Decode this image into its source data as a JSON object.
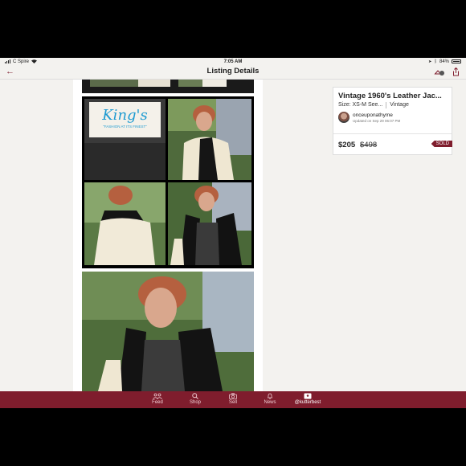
{
  "status": {
    "carrier": "C Spire",
    "time": "7:05 AM",
    "battery": "84%"
  },
  "nav": {
    "title": "Listing Details"
  },
  "photos": {
    "brand_label_main": "King's",
    "brand_label_sub": "\"FASHION AT ITS FINEST\""
  },
  "listing": {
    "title": "Vintage 1960's Leather Jac...",
    "size": "Size: XS-M See...",
    "category": "Vintage",
    "seller": "onceuponathyme",
    "updated": "Updated on Sep 29 06:07 PM",
    "price": "$205",
    "original_price": "$498",
    "status_badge": "SOLD"
  },
  "tabbar": {
    "tabs": [
      {
        "label": "Feed"
      },
      {
        "label": "Shop"
      },
      {
        "label": "Sell"
      },
      {
        "label": "News"
      },
      {
        "label": "@kutterbest"
      }
    ]
  },
  "colors": {
    "brand": "#7f1d2d",
    "background": "#f3f2ef"
  }
}
